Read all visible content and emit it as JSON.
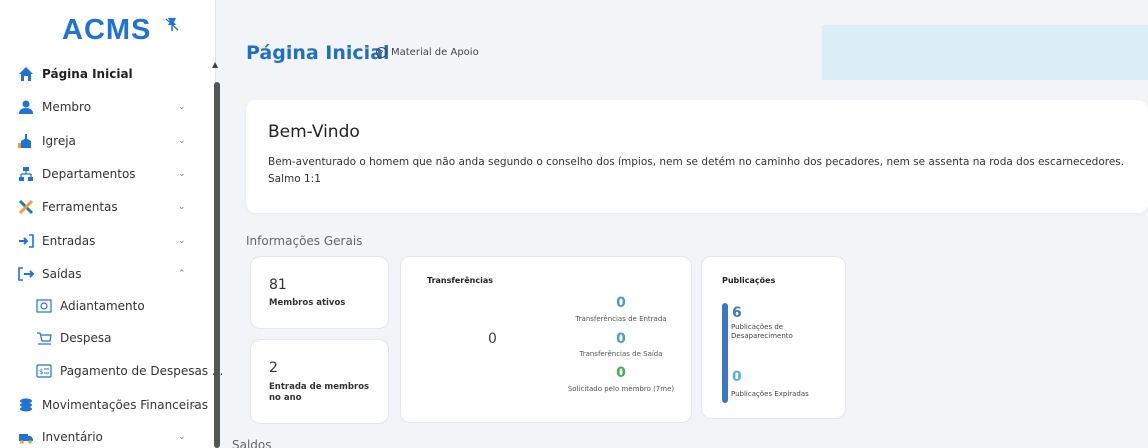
{
  "sidebar": {
    "logo": "ACMS",
    "items": [
      {
        "label": "Página Inicial",
        "icon": "home-icon"
      },
      {
        "label": "Membro",
        "icon": "user-icon"
      },
      {
        "label": "Igreja",
        "icon": "church-icon"
      },
      {
        "label": "Departamentos",
        "icon": "sitemap-icon"
      },
      {
        "label": "Ferramentas",
        "icon": "tools-icon"
      },
      {
        "label": "Entradas",
        "icon": "sign-in-icon"
      },
      {
        "label": "Saídas",
        "icon": "sign-out-icon"
      },
      {
        "label": "Movimentações Financeiras",
        "icon": "coins-icon"
      },
      {
        "label": "Inventário",
        "icon": "truck-icon"
      }
    ],
    "sub_items": [
      {
        "label": "Adiantamento",
        "icon": "advance-icon"
      },
      {
        "label": "Despesa",
        "icon": "cart-icon"
      },
      {
        "label": "Pagamento de Despesas ...",
        "icon": "payment-icon"
      }
    ]
  },
  "header": {
    "title": "Página Inicial",
    "help_label": "Material de Apoio"
  },
  "welcome": {
    "title": "Bem-Vindo",
    "verse": "Bem-aventurado o homem que não anda segundo o conselho dos ímpios, nem se detém no caminho dos pecadores, nem se assenta na roda dos escarnecedores.",
    "reference": "Salmo 1:1"
  },
  "general": {
    "section_label": "Informações Gerais",
    "active_members": {
      "value": "81",
      "label": "Membros ativos"
    },
    "new_members": {
      "value": "2",
      "label": "Entrada de membros no ano"
    },
    "transfers": {
      "title": "Transferências",
      "total": "0",
      "in_value": "0",
      "in_label": "Transferências de Entrada",
      "out_value": "0",
      "out_label": "Transferências de Saída",
      "requested_value": "0",
      "requested_label": "Solicitado pelo membro (7me)"
    },
    "publications": {
      "title": "Publicações",
      "disappearance_value": "6",
      "disappearance_label": "Publicações de Desaparecimento",
      "expired_value": "0",
      "expired_label": "Publicações Expiradas"
    }
  },
  "balances": {
    "section_label": "Saldos"
  },
  "colors": {
    "brand": "#1e73d8",
    "accent_blue": "#4a9ad8",
    "accent_green": "#3bb44a",
    "banner": "#dbeef8"
  }
}
